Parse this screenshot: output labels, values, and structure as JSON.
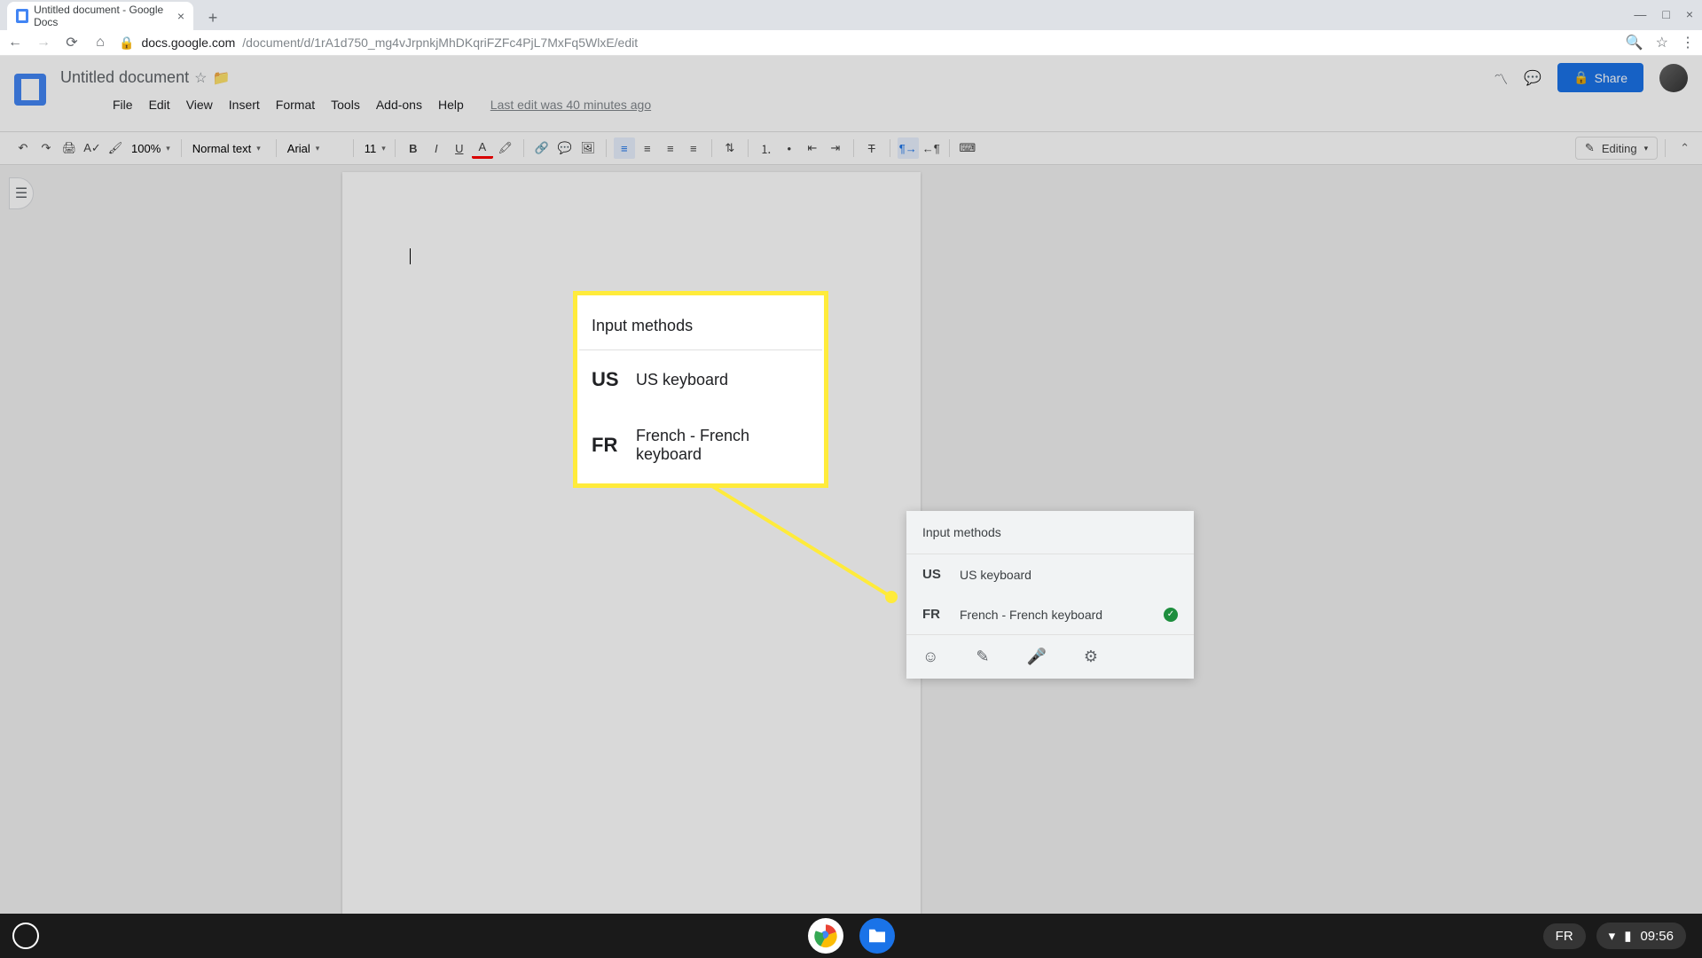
{
  "browser": {
    "tab_title": "Untitled document - Google Docs",
    "url_host": "docs.google.com",
    "url_path": "/document/d/1rA1d750_mg4vJrpnkjMhDKqriFZFc4PjL7MxFq5WlxE/edit"
  },
  "docs": {
    "title": "Untitled document",
    "last_edit": "Last edit was 40 minutes ago",
    "menu": [
      "File",
      "Edit",
      "View",
      "Insert",
      "Format",
      "Tools",
      "Add-ons",
      "Help"
    ],
    "share_label": "Share"
  },
  "toolbar": {
    "zoom": "100%",
    "style": "Normal text",
    "font": "Arial",
    "size": "11",
    "mode": "Editing"
  },
  "input_methods": {
    "title": "Input methods",
    "items": [
      {
        "code": "US",
        "label": "US keyboard",
        "selected": false
      },
      {
        "code": "FR",
        "label": "French - French keyboard",
        "selected": true
      }
    ]
  },
  "system": {
    "ime_code": "FR",
    "time": "09:56"
  }
}
